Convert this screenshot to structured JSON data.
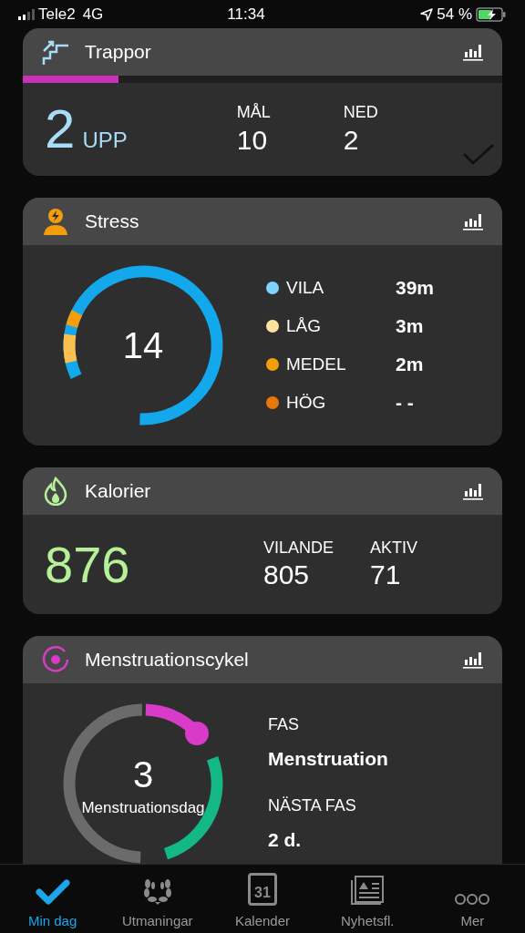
{
  "status_bar": {
    "carrier": "Tele2",
    "network": "4G",
    "time": "11:34",
    "battery": "54 %"
  },
  "stairs": {
    "title": "Trappor",
    "level": 0.2,
    "value": "2",
    "unit": "UPP",
    "stats": [
      {
        "label": "MÅL",
        "value": "10"
      },
      {
        "label": "NED",
        "value": "2"
      }
    ]
  },
  "stress": {
    "title": "Stress",
    "value": "14",
    "legend": [
      {
        "label": "VILA",
        "value": "39m",
        "color": "#7dd3fc"
      },
      {
        "label": "LÅG",
        "value": "3m",
        "color": "#fde2a0"
      },
      {
        "label": "MEDEL",
        "value": "2m",
        "color": "#f59e0b"
      },
      {
        "label": "HÖG",
        "value": "- -",
        "color": "#e8780a"
      }
    ]
  },
  "calories": {
    "title": "Kalorier",
    "value": "876",
    "stats": [
      {
        "label": "VILANDE",
        "value": "805"
      },
      {
        "label": "AKTIV",
        "value": "71"
      }
    ]
  },
  "cycle": {
    "title": "Menstruationscykel",
    "day": "3",
    "day_label": "Menstruationsdag",
    "phase_label": "FAS",
    "phase": "Menstruation",
    "next_label": "NÄSTA FAS",
    "next": "2 d."
  },
  "tabs": [
    {
      "label": "Min dag",
      "kind": "check",
      "selected": true
    },
    {
      "label": "Utmaningar",
      "kind": "laurel",
      "selected": false
    },
    {
      "label": "Kalender",
      "kind": "calendar",
      "day": "31",
      "selected": false
    },
    {
      "label": "Nyhetsfl.",
      "kind": "news",
      "selected": false
    },
    {
      "label": "Mer",
      "kind": "more",
      "selected": false
    }
  ]
}
